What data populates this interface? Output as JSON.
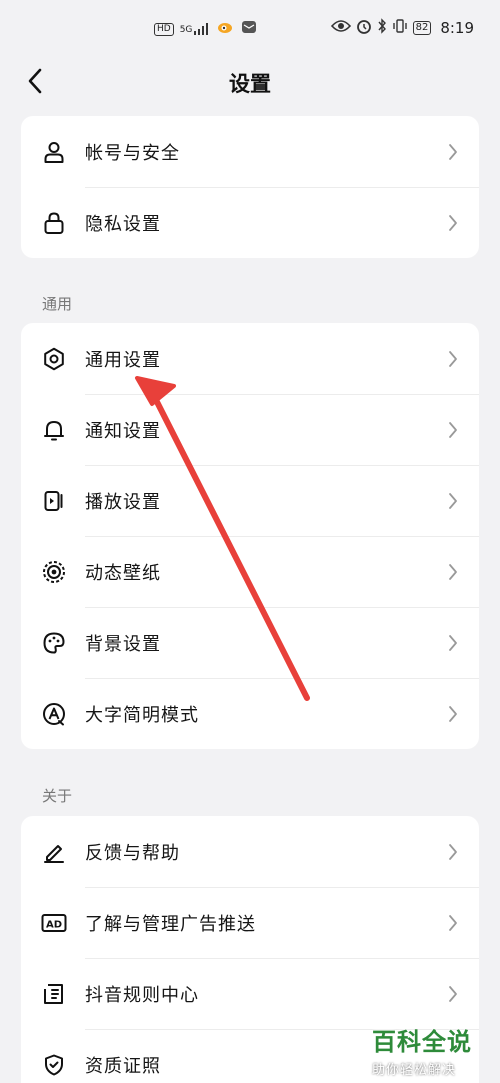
{
  "status_bar": {
    "hd": "HD",
    "signal": "5G",
    "battery": "82",
    "time": "8:19"
  },
  "header": {
    "title": "设置"
  },
  "account_section": {
    "items": [
      {
        "label": "帐号与安全",
        "icon": "person-icon"
      },
      {
        "label": "隐私设置",
        "icon": "lock-icon"
      }
    ]
  },
  "general_section": {
    "title": "通用",
    "items": [
      {
        "label": "通用设置",
        "icon": "gear-icon"
      },
      {
        "label": "通知设置",
        "icon": "bell-icon"
      },
      {
        "label": "播放设置",
        "icon": "play-icon"
      },
      {
        "label": "动态壁纸",
        "icon": "wallpaper-icon"
      },
      {
        "label": "背景设置",
        "icon": "palette-icon"
      },
      {
        "label": "大字简明模式",
        "icon": "large-font-icon"
      }
    ]
  },
  "about_section": {
    "title": "关于",
    "items": [
      {
        "label": "反馈与帮助",
        "icon": "pencil-icon"
      },
      {
        "label": "了解与管理广告推送",
        "icon": "ad-icon"
      },
      {
        "label": "抖音规则中心",
        "icon": "rules-icon"
      },
      {
        "label": "资质证照",
        "icon": "shield-check-icon"
      }
    ]
  },
  "watermark": {
    "main": "百科全说",
    "sub": "助你轻松解决"
  },
  "colors": {
    "background": "#f2f2f4",
    "card": "#ffffff",
    "annotation_arrow": "#e8403a",
    "watermark_green": "#2e8b3a"
  }
}
